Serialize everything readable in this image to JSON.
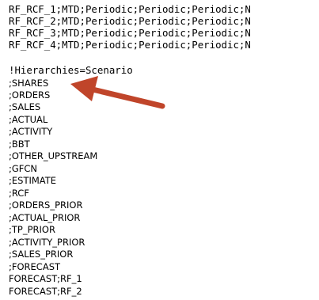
{
  "header_lines": [
    "RF_RCF_1;MTD;Periodic;Periodic;Periodic;N",
    "RF_RCF_2;MTD;Periodic;Periodic;Periodic;N",
    "RF_RCF_3;MTD;Periodic;Periodic;Periodic;N",
    "RF_RCF_4;MTD;Periodic;Periodic;Periodic;N"
  ],
  "hierarchy_heading": "!Hierarchies=Scenario",
  "scenario_items": [
    ";SHARES",
    ";ORDERS",
    ";SALES",
    ";ACTUAL",
    ";ACTIVITY",
    ";BBT",
    ";OTHER_UPSTREAM",
    ";GFCN",
    ";ESTIMATE",
    ";RCF",
    ";ORDERS_PRIOR",
    ";ACTUAL_PRIOR",
    ";TP_PRIOR",
    ";ACTIVITY_PRIOR",
    ";SALES_PRIOR",
    ";FORECAST",
    "FORECAST;RF_1",
    "FORECAST;RF_2"
  ],
  "annotation_arrow": {
    "color": "#c0452a",
    "points_to": ";SHARES"
  }
}
